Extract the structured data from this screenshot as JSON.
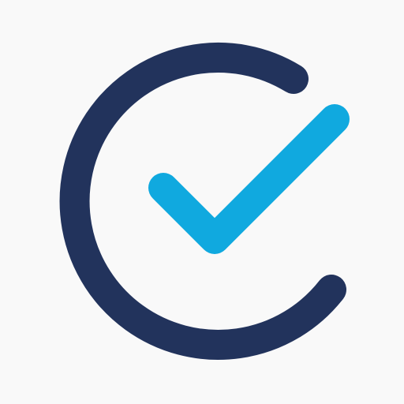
{
  "icon": {
    "name": "check-circle-icon",
    "arc_color": "#22335c",
    "check_color": "#10a9df",
    "background_color": "#f9f9f9"
  }
}
